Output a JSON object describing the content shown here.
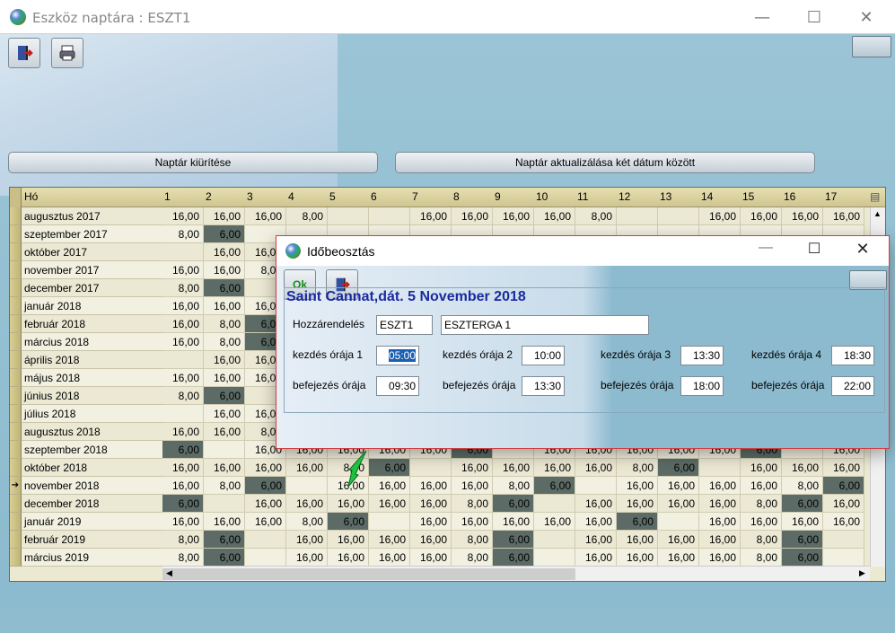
{
  "window": {
    "title": "Eszköz naptára : ESZT1",
    "minimize": "—",
    "maximize": "☐",
    "close": "✕"
  },
  "toolbar": {
    "exit_icon": "exit-door-icon",
    "print_icon": "printer-icon"
  },
  "buttons": {
    "clear": "Naptár kiürítése",
    "update": "Naptár aktualizálása két dátum között"
  },
  "grid": {
    "header_label": "Hó",
    "days": [
      "1",
      "2",
      "3",
      "4",
      "5",
      "6",
      "7",
      "8",
      "9",
      "10",
      "11",
      "12",
      "13",
      "14",
      "15",
      "16",
      "17"
    ],
    "current_row_index": 15,
    "rows": [
      {
        "label": "augusztus 2017",
        "cells": [
          "16,00",
          "16,00",
          "16,00",
          "8,00",
          "",
          "",
          "16,00",
          "16,00",
          "16,00",
          "16,00",
          "8,00",
          "",
          "",
          "16,00",
          "16,00",
          "16,00",
          "16,00"
        ],
        "dark": []
      },
      {
        "label": "szeptember 2017",
        "cells": [
          "8,00",
          "6,00",
          "",
          "",
          "",
          "",
          "",
          "",
          "",
          "",
          "",
          "",
          "",
          "",
          "",
          "",
          ""
        ],
        "dark": [
          1
        ]
      },
      {
        "label": "október 2017",
        "cells": [
          "",
          "16,00",
          "16,00",
          "",
          "",
          "",
          "",
          "",
          "",
          "",
          "",
          "",
          "",
          "",
          "",
          "",
          ""
        ],
        "dark": []
      },
      {
        "label": "november 2017",
        "cells": [
          "16,00",
          "16,00",
          "8,00",
          "",
          "",
          "",
          "",
          "",
          "",
          "",
          "",
          "",
          "",
          "",
          "",
          "",
          ""
        ],
        "dark": []
      },
      {
        "label": "december 2017",
        "cells": [
          "8,00",
          "6,00",
          "",
          "",
          "",
          "",
          "",
          "",
          "",
          "",
          "",
          "",
          "",
          "",
          "",
          "",
          ""
        ],
        "dark": [
          1
        ]
      },
      {
        "label": "január 2018",
        "cells": [
          "16,00",
          "16,00",
          "16,00",
          "",
          "",
          "",
          "",
          "",
          "",
          "",
          "",
          "",
          "",
          "",
          "",
          "",
          ""
        ],
        "dark": []
      },
      {
        "label": "február 2018",
        "cells": [
          "16,00",
          "8,00",
          "6,00",
          "",
          "",
          "",
          "",
          "",
          "",
          "",
          "",
          "",
          "",
          "",
          "",
          "",
          ""
        ],
        "dark": [
          2
        ]
      },
      {
        "label": "március 2018",
        "cells": [
          "16,00",
          "8,00",
          "6,00",
          "",
          "",
          "",
          "",
          "",
          "",
          "",
          "",
          "",
          "",
          "",
          "",
          "",
          ""
        ],
        "dark": [
          2
        ]
      },
      {
        "label": "április 2018",
        "cells": [
          "",
          "16,00",
          "16,00",
          "",
          "",
          "",
          "",
          "",
          "",
          "",
          "",
          "",
          "",
          "",
          "",
          "",
          ""
        ],
        "dark": []
      },
      {
        "label": "május 2018",
        "cells": [
          "16,00",
          "16,00",
          "16,00",
          "",
          "",
          "",
          "",
          "",
          "",
          "",
          "",
          "",
          "",
          "",
          "",
          "",
          ""
        ],
        "dark": []
      },
      {
        "label": "június 2018",
        "cells": [
          "8,00",
          "6,00",
          "",
          "",
          "",
          "",
          "",
          "",
          "",
          "",
          "",
          "",
          "",
          "",
          "",
          "",
          ""
        ],
        "dark": [
          1
        ]
      },
      {
        "label": "július 2018",
        "cells": [
          "",
          "16,00",
          "16,00",
          "",
          "",
          "",
          "",
          "",
          "",
          "",
          "",
          "",
          "",
          "",
          "",
          "",
          ""
        ],
        "dark": []
      },
      {
        "label": "augusztus 2018",
        "cells": [
          "16,00",
          "16,00",
          "8,00",
          "",
          "",
          "",
          "",
          "",
          "",
          "",
          "",
          "",
          "",
          "",
          "",
          "",
          ""
        ],
        "dark": []
      },
      {
        "label": "szeptember 2018",
        "cells": [
          "6,00",
          "",
          "16,00",
          "16,00",
          "16,00",
          "16,00",
          "16,00",
          "6,00",
          "",
          "16,00",
          "16,00",
          "16,00",
          "16,00",
          "16,00",
          "6,00",
          "",
          "16,00"
        ],
        "dark": [
          0,
          7,
          14
        ]
      },
      {
        "label": "október 2018",
        "cells": [
          "16,00",
          "16,00",
          "16,00",
          "16,00",
          "8,00",
          "6,00",
          "",
          "16,00",
          "16,00",
          "16,00",
          "16,00",
          "8,00",
          "6,00",
          "",
          "16,00",
          "16,00",
          "16,00"
        ],
        "dark": [
          5,
          12
        ]
      },
      {
        "label": "november 2018",
        "cells": [
          "16,00",
          "8,00",
          "6,00",
          "",
          "16,00",
          "16,00",
          "16,00",
          "16,00",
          "8,00",
          "6,00",
          "",
          "16,00",
          "16,00",
          "16,00",
          "16,00",
          "8,00",
          "6,00"
        ],
        "dark": [
          2,
          9,
          16
        ]
      },
      {
        "label": "december 2018",
        "cells": [
          "6,00",
          "",
          "16,00",
          "16,00",
          "16,00",
          "16,00",
          "16,00",
          "8,00",
          "6,00",
          "",
          "16,00",
          "16,00",
          "16,00",
          "16,00",
          "8,00",
          "6,00",
          "16,00"
        ],
        "dark": [
          0,
          8,
          15
        ]
      },
      {
        "label": "január 2019",
        "cells": [
          "16,00",
          "16,00",
          "16,00",
          "8,00",
          "6,00",
          "",
          "16,00",
          "16,00",
          "16,00",
          "16,00",
          "16,00",
          "6,00",
          "",
          "16,00",
          "16,00",
          "16,00",
          "16,00"
        ],
        "dark": [
          4,
          11
        ]
      },
      {
        "label": "február 2019",
        "cells": [
          "8,00",
          "6,00",
          "",
          "16,00",
          "16,00",
          "16,00",
          "16,00",
          "8,00",
          "6,00",
          "",
          "16,00",
          "16,00",
          "16,00",
          "16,00",
          "8,00",
          "6,00",
          ""
        ],
        "dark": [
          1,
          8,
          15
        ]
      },
      {
        "label": "március 2019",
        "cells": [
          "8,00",
          "6,00",
          "",
          "16,00",
          "16,00",
          "16,00",
          "16,00",
          "8,00",
          "6,00",
          "",
          "16,00",
          "16,00",
          "16,00",
          "16,00",
          "8,00",
          "6,00",
          ""
        ],
        "dark": [
          1,
          8,
          15
        ]
      }
    ]
  },
  "dialog": {
    "title": "Időbeosztás",
    "ok": "Ok",
    "heading": "Saint Cannat,dát. 5 November 2018",
    "assign_label": "Hozzárendelés",
    "assign_code": "ESZT1",
    "assign_name": "ESZTERGA 1",
    "start_labels": [
      "kezdés órája 1",
      "kezdés órája 2",
      "kezdés órája 3",
      "kezdés órája 4"
    ],
    "start_values": [
      "05:00",
      "10:00",
      "13:30",
      "18:30"
    ],
    "end_labels": [
      "befejezés órája",
      "befejezés órája",
      "befejezés órája",
      "befejezés órája"
    ],
    "end_values": [
      "09:30",
      "13:30",
      "18:00",
      "22:00"
    ]
  }
}
